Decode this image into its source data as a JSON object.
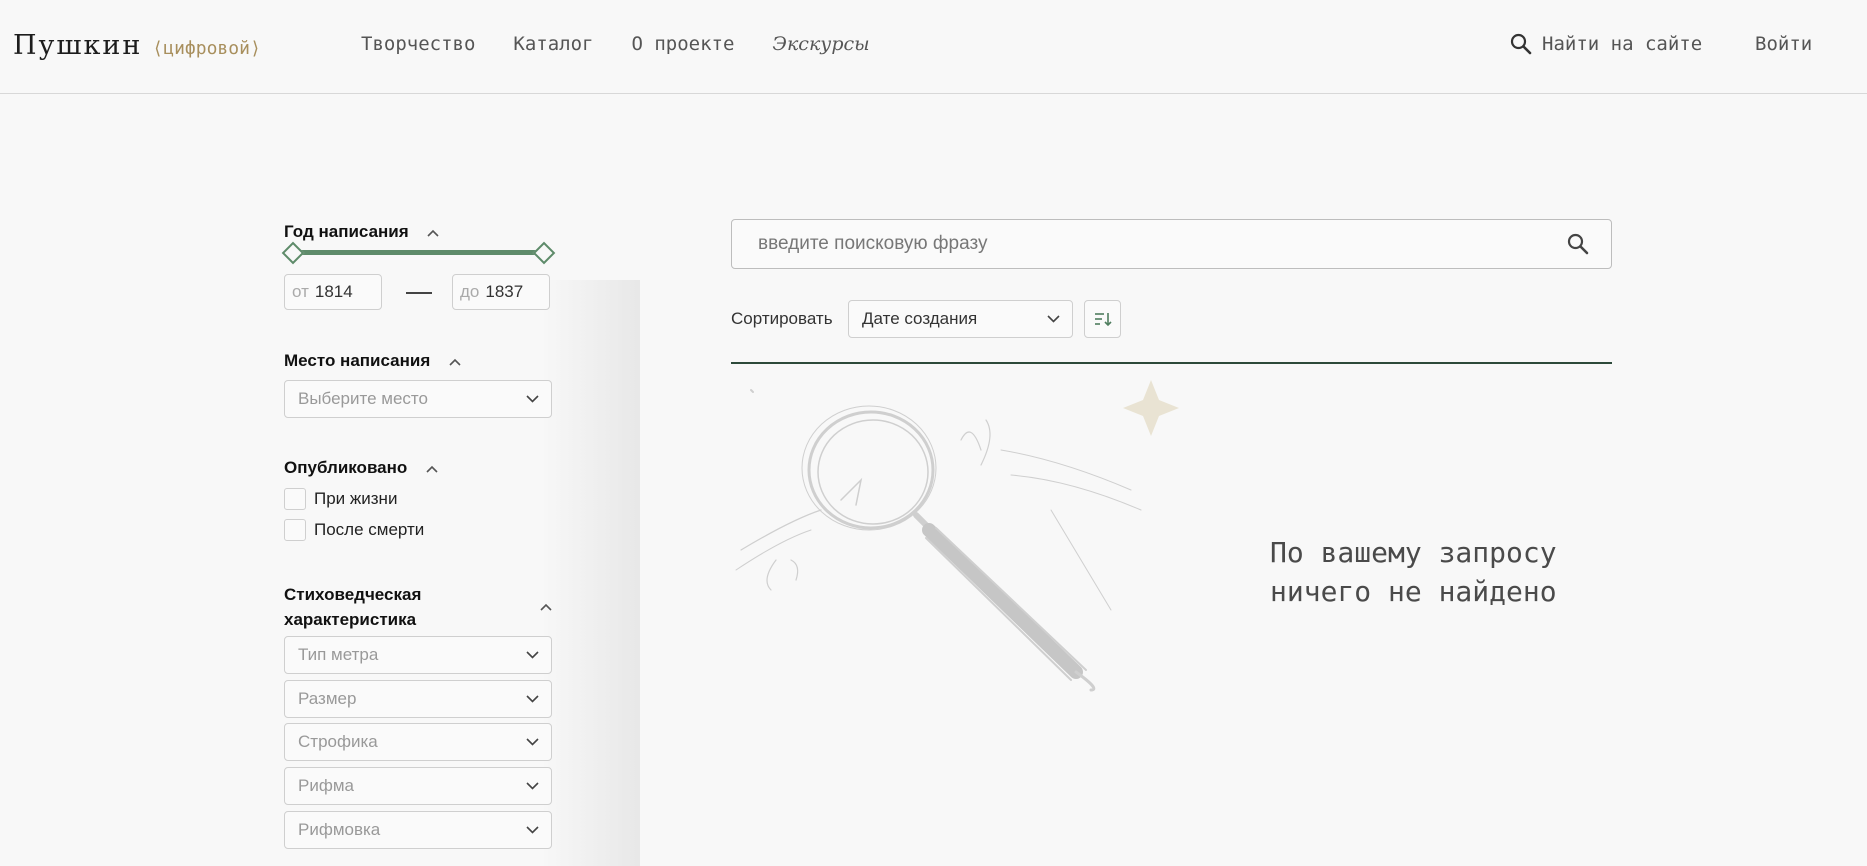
{
  "header": {
    "logo_main": "Пушкин",
    "logo_sub": "⟨цифровой⟩",
    "nav": [
      "Творчество",
      "Каталог",
      "О проекте",
      "Экскурсы"
    ],
    "site_search_label": "Найти на сайте",
    "login_label": "Войти"
  },
  "filters": {
    "year": {
      "title": "Год написания",
      "from_prefix": "от",
      "from_value": "1814",
      "to_prefix": "до",
      "to_value": "1837"
    },
    "place": {
      "title": "Место написания",
      "placeholder": "Выберите место"
    },
    "published": {
      "title": "Опубликовано",
      "options": [
        "При жизни",
        "После смерти"
      ]
    },
    "verse": {
      "title_line1": "Стиховедческая",
      "title_line2": "характеристика",
      "selects": [
        "Тип метра",
        "Размер",
        "Строфика",
        "Рифма",
        "Рифмовка"
      ]
    }
  },
  "main": {
    "search_placeholder": "введите поисковую фразу",
    "sort_label": "Сортировать",
    "sort_value": "Дате создания",
    "empty_message": "По вашему запросу\nничего не найдено"
  },
  "colors": {
    "accent_green": "#5e8b6a",
    "logo_gold": "#a88f5d",
    "divider_dark": "#2d4a3a"
  },
  "icons": [
    "search-icon",
    "chevron-up-icon",
    "chevron-down-icon",
    "sort-order-icon",
    "magnifier-illustration"
  ]
}
